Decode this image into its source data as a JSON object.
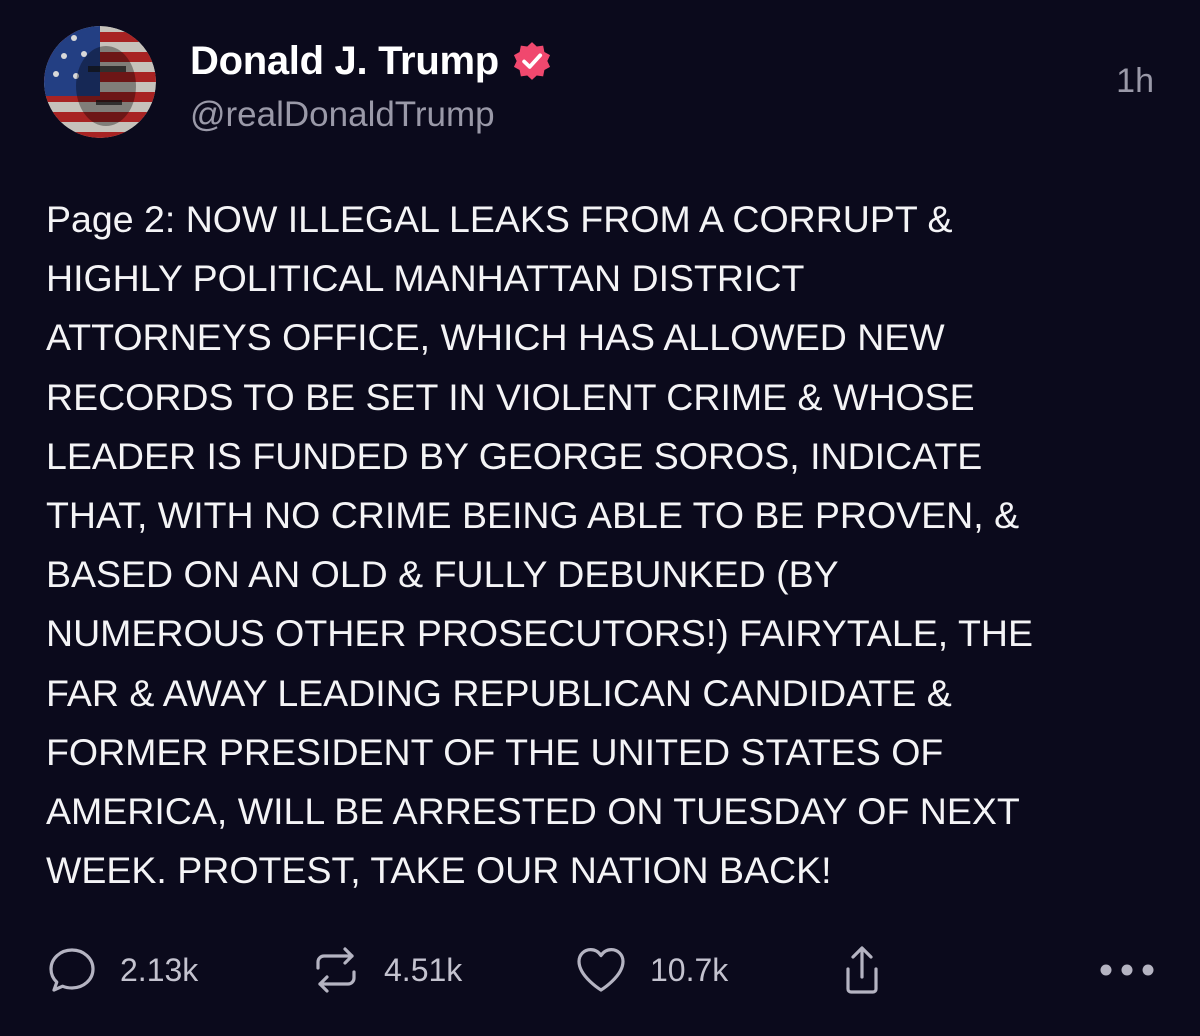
{
  "post": {
    "author": {
      "display_name": "Donald J. Trump",
      "handle": "@realDonaldTrump",
      "verified": true,
      "verified_color": "#f0486e",
      "avatar_icon": "flag-portrait-avatar"
    },
    "timestamp": "1h",
    "text": "Page 2: NOW ILLEGAL LEAKS FROM A CORRUPT &\nHIGHLY POLITICAL MANHATTAN DISTRICT\nATTORNEYS OFFICE, WHICH HAS ALLOWED NEW\nRECORDS TO BE SET IN VIOLENT CRIME & WHOSE\nLEADER IS FUNDED BY GEORGE SOROS, INDICATE\nTHAT, WITH NO CRIME BEING ABLE TO BE PROVEN, &\nBASED ON AN OLD & FULLY DEBUNKED (BY\nNUMEROUS OTHER PROSECUTORS!) FAIRYTALE, THE\nFAR & AWAY LEADING REPUBLICAN CANDIDATE &\nFORMER PRESIDENT OF THE UNITED STATES OF\nAMERICA, WILL BE ARRESTED ON TUESDAY OF NEXT\nWEEK. PROTEST, TAKE OUR NATION BACK!",
    "actions": {
      "replies": {
        "icon": "reply-icon",
        "count": "2.13k"
      },
      "reposts": {
        "icon": "repost-icon",
        "count": "4.51k"
      },
      "likes": {
        "icon": "heart-icon",
        "count": "10.7k"
      },
      "share": {
        "icon": "share-icon"
      },
      "more": {
        "icon": "more-icon"
      }
    }
  },
  "colors": {
    "background": "#0b0a1c",
    "text": "#f4f4f6",
    "muted": "#9a99a8"
  }
}
